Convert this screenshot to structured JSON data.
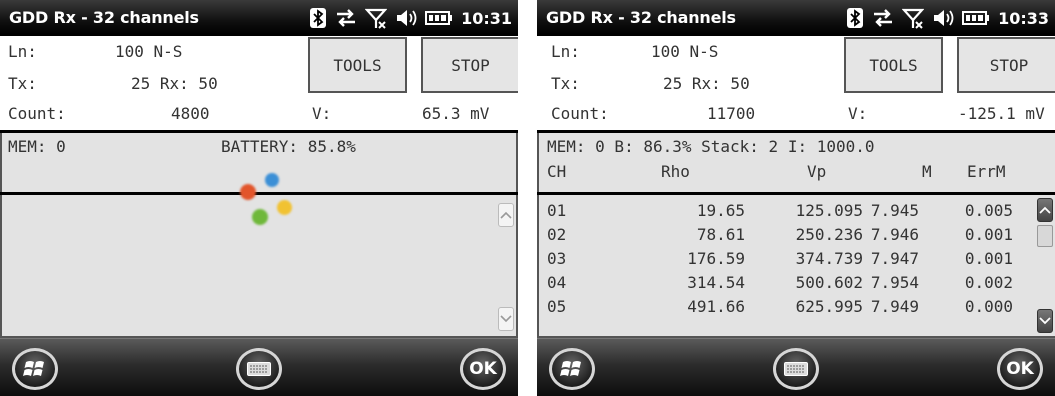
{
  "screen1": {
    "title": "GDD Rx - 32 channels",
    "time": "10:31",
    "ln_label": "Ln:",
    "ln_value": "100 N-S",
    "tx_label": "Tx:",
    "tx_value": "25 Rx: 50",
    "count_label": "Count:",
    "count_value": "4800",
    "v_label": "V:",
    "v_value": "65.3 mV",
    "tools_label": "TOOLS",
    "stop_label": "STOP",
    "mem_text": "MEM: 0",
    "battery_text": "BATTERY: 85.8%",
    "ok_label": "OK",
    "loading_colors": [
      "#e2552b",
      "#3b8fd6",
      "#f1c232",
      "#6fb83a"
    ]
  },
  "screen2": {
    "title": "GDD Rx - 32 channels",
    "time": "10:33",
    "ln_label": "Ln:",
    "ln_value": "100 N-S",
    "tx_label": "Tx:",
    "tx_value": "25 Rx: 50",
    "count_label": "Count:",
    "count_value": "11700",
    "v_label": "V:",
    "v_value": "-125.1 mV",
    "tools_label": "TOOLS",
    "stop_label": "STOP",
    "summary_text": "MEM: 0 B: 86.3% Stack: 2 I: 1000.0",
    "columns": [
      "CH",
      "Rho",
      "Vp",
      "M",
      "ErrM"
    ],
    "rows": [
      [
        "01",
        "19.65",
        "125.095",
        "7.945",
        "0.005"
      ],
      [
        "02",
        "78.61",
        "250.236",
        "7.946",
        "0.001"
      ],
      [
        "03",
        "176.59",
        "374.739",
        "7.947",
        "0.001"
      ],
      [
        "04",
        "314.54",
        "500.602",
        "7.954",
        "0.002"
      ],
      [
        "05",
        "491.66",
        "625.995",
        "7.949",
        "0.000"
      ]
    ],
    "ok_label": "OK"
  },
  "icons": [
    "bluetooth-icon",
    "sync-arrows-icon",
    "no-signal-icon",
    "volume-icon",
    "battery-icon",
    "windows-start-icon",
    "keyboard-icon",
    "scroll-up-icon",
    "scroll-down-icon"
  ]
}
